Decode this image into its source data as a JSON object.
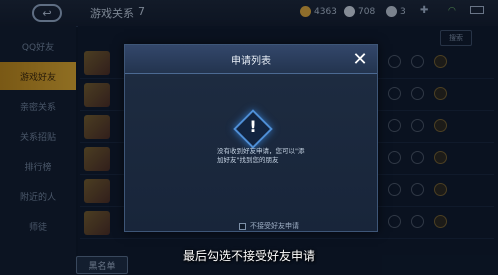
{
  "topbar": {
    "back_icon": "back-arrow-icon",
    "title": "游戏关系",
    "count": "7",
    "resources": [
      {
        "icon": "gold-coin-icon",
        "value": "4363",
        "color": "#d7a43a"
      },
      {
        "icon": "diamond-icon",
        "value": "708",
        "color": "#c9d3de"
      },
      {
        "icon": "coupon-icon",
        "value": "3",
        "color": "#b9c3cf"
      }
    ]
  },
  "sidebar": {
    "items": [
      {
        "label": "QQ好友"
      },
      {
        "label": "游戏好友",
        "active": true
      },
      {
        "label": "亲密关系"
      },
      {
        "label": "关系招贴"
      },
      {
        "label": "排行榜"
      },
      {
        "label": "附近的人"
      },
      {
        "label": "师徒"
      }
    ]
  },
  "list": {
    "search_label": "搜索",
    "blacklist_label": "黑名单"
  },
  "dialog": {
    "title": "申请列表",
    "close_icon": "close-icon",
    "warning_icon": "warning-diamond-icon",
    "message": "没有收到好友申请，您可以\"添加好友\"找到您的朋友",
    "checkbox_label": "不接受好友申请",
    "checkbox_checked": false
  },
  "caption": "最后勾选不接受好友申请"
}
